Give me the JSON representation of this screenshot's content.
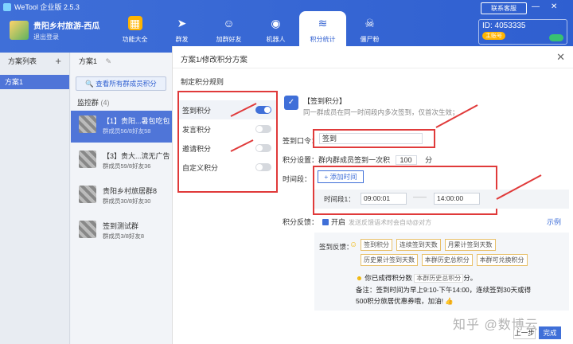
{
  "app": {
    "title": "WeTool 企业版 2.5.3"
  },
  "account": {
    "name": "贵阳乡村旅游-西瓜",
    "logout": "退出登录"
  },
  "nav": [
    {
      "label": "功能大全",
      "icon": "grid-icon"
    },
    {
      "label": "群发",
      "icon": "send-icon"
    },
    {
      "label": "加群好友",
      "icon": "add-friend-icon"
    },
    {
      "label": "机器人",
      "icon": "robot-icon"
    },
    {
      "label": "积分统计",
      "icon": "database-icon"
    },
    {
      "label": "僵尸粉",
      "icon": "skull-icon"
    }
  ],
  "header_right": {
    "help": "联系客服",
    "id_label": "ID: 4053335",
    "badge": "主账号"
  },
  "plans": {
    "title": "方案列表",
    "items": [
      "方案1"
    ]
  },
  "groups": {
    "title": "方案1",
    "view_all": "查看所有群成员积分",
    "monitor": "监控群",
    "monitor_count": "(4)",
    "items": [
      {
        "name": "【1】贵阳...暑包吃包住",
        "sub": "群成员56/8好友58"
      },
      {
        "name": "【3】贵大...流无广告群",
        "sub": "群成员59/8好友36"
      },
      {
        "name": "贵阳乡村旅居群8",
        "sub": "群成员30/8好友30"
      },
      {
        "name": "签到测试群",
        "sub": "群成员3/8好友8"
      }
    ]
  },
  "dialog": {
    "title": "方案1/修改积分方案",
    "rules_title": "制定积分规则",
    "rules": [
      {
        "label": "签到积分",
        "on": true
      },
      {
        "label": "发言积分",
        "on": false
      },
      {
        "label": "邀请积分",
        "on": false
      },
      {
        "label": "自定义积分",
        "on": false
      }
    ],
    "rule_head": "【签到积分】",
    "rule_desc": "同一群成员在同一时间段内多次签到，仅首次生效；",
    "keyword_label": "签到口令：",
    "keyword_value": "签到",
    "points_label": "积分设置：",
    "points_text": "群内群成员签到一次积",
    "points_value": "100",
    "points_unit": "分",
    "time_label": "时间段：",
    "add_time": "+ 添加时间",
    "period_label": "时间段1：",
    "start_time": "09:00:01",
    "end_time": "14:00:00",
    "feedback_label": "积分反馈：",
    "feedback_enable": "开启",
    "feedback_hint": "发送反馈语术时会自动@对方",
    "example": "示例",
    "fb_title": "签到反馈：",
    "tags": [
      "签到积分",
      "连续签到天数",
      "月累计签到天数",
      "历史累计签到天数",
      "本群历史总积分",
      "本群可兑换积分"
    ],
    "fb_line1": "你已成得积分数",
    "fb_tooltip": "本群历史总积分",
    "fb_line1_end": "分。",
    "fb_line2": "备注：签到时间为早上9:10-下午14:00，连续签到30天或得",
    "fb_line3": "500积分旅居优惠券哦，加油!",
    "btn_prev": "上一步",
    "btn_done": "完成"
  },
  "watermark": "知乎 @数博云",
  "accent": "#3f6fd8",
  "highlight": "#e03a3a"
}
